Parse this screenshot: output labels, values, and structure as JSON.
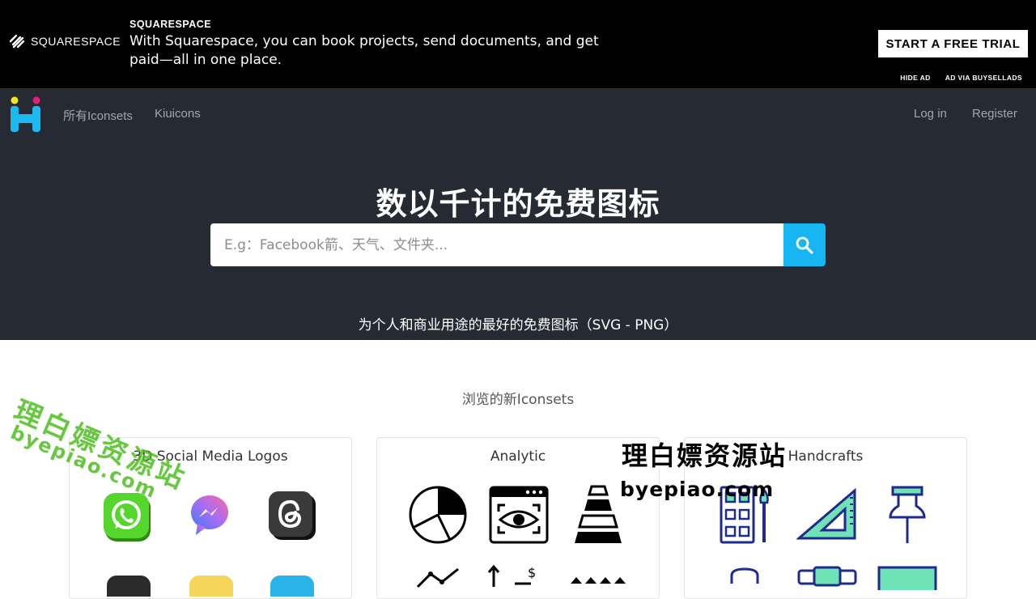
{
  "ad": {
    "logo_text": "SQUARESPACE",
    "brand": "SQUARESPACE",
    "copy": "With Squarespace, you can book projects, send documents, and get paid—all in one place.",
    "cta": "START A FREE TRIAL",
    "hide_ad": "HIDE AD",
    "ad_via": "AD VIA BUYSELLADS"
  },
  "nav": {
    "all_iconsets": "所有Iconsets",
    "kiuicons": "Kiuicons",
    "login": "Log in",
    "register": "Register"
  },
  "hero": {
    "title": "数以千计的免费图标",
    "search_placeholder": "E.g：Facebook箭、天气、文件夹...",
    "subtitle": "为个人和商业用途的最好的免费图标（SVG - PNG）"
  },
  "section": {
    "title": "浏览的新Iconsets"
  },
  "cards": [
    {
      "title": "3D Social Media Logos"
    },
    {
      "title": "Analytic"
    },
    {
      "title": "Handcrafts"
    }
  ],
  "watermarks": {
    "cn": "理白嫖资源站",
    "url": "byepiao.com"
  },
  "colors": {
    "ad_bg": "#000000",
    "hero_bg": "#262b33",
    "search_button": "#17b5f2",
    "logo_yellow": "#f7e51b",
    "logo_pink": "#ec1c7b",
    "logo_blue": "#1cb8f0",
    "handcraft_outline": "#1f2a8c",
    "handcraft_fill": "#6fe3b6",
    "watermark_green": "#4cbf1e"
  },
  "icons": [
    "squarespace-logo-icon",
    "site-logo-icon",
    "search-icon",
    "whatsapp-icon",
    "messenger-icon",
    "threads-icon",
    "pie-chart-icon",
    "browser-eye-icon",
    "pyramid-chart-icon",
    "line-chart-icon",
    "arrow-dollar-icon",
    "bar-pyramid-icon",
    "palette-brushes-icon",
    "set-square-icon",
    "pushpin-icon"
  ]
}
